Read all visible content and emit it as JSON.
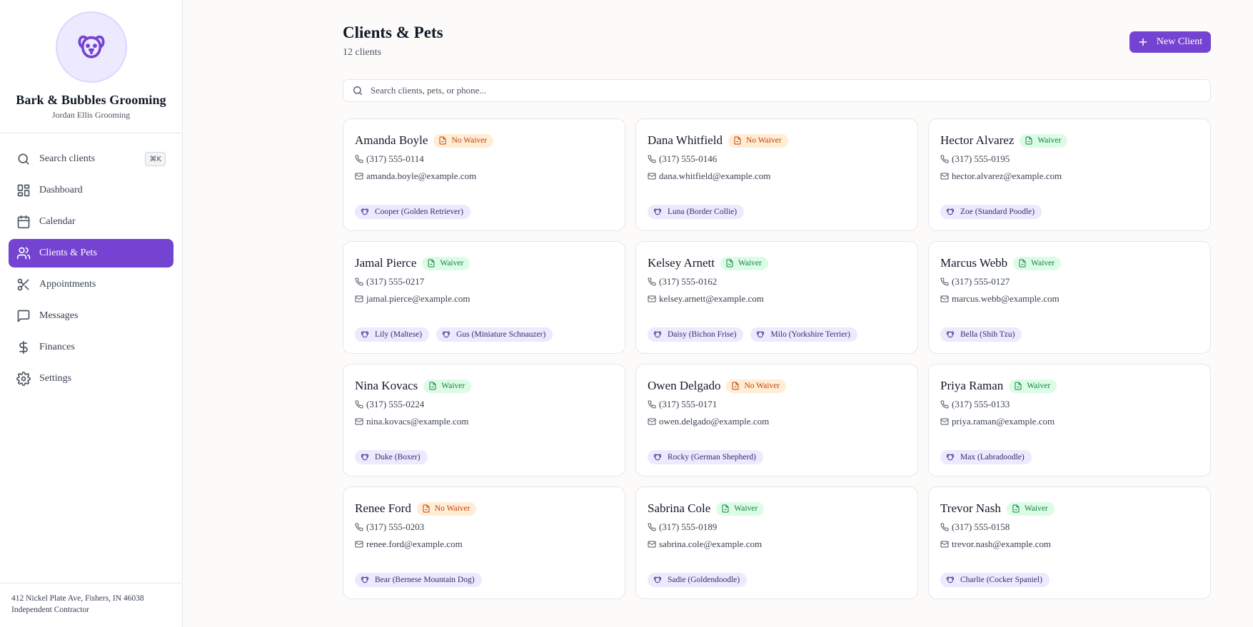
{
  "brand": {
    "name": "Bark & Bubbles Grooming",
    "subtitle": "Jordan Ellis Grooming"
  },
  "nav": [
    {
      "label": "Search clients",
      "icon": "search-icon",
      "shortcut": "⌘K"
    },
    {
      "label": "Dashboard",
      "icon": "dashboard-icon"
    },
    {
      "label": "Calendar",
      "icon": "calendar-icon"
    },
    {
      "label": "Clients & Pets",
      "icon": "users-icon",
      "active": true
    },
    {
      "label": "Appointments",
      "icon": "scissors-icon"
    },
    {
      "label": "Messages",
      "icon": "message-icon"
    },
    {
      "label": "Finances",
      "icon": "dollar-icon"
    },
    {
      "label": "Settings",
      "icon": "gear-icon"
    }
  ],
  "footer": {
    "address": "412 Nickel Plate Ave, Fishers, IN 46038",
    "role": "Independent Contractor"
  },
  "header": {
    "title": "Clients & Pets",
    "count": "12 clients",
    "new_button": "New Client"
  },
  "search": {
    "placeholder": "Search clients, pets, or phone..."
  },
  "colors": {
    "accent": "#7443d2",
    "waiver_bg": "#dcfce7",
    "no_waiver_bg": "#ffedd5",
    "pet_bg": "#ede9fe"
  },
  "clients": [
    {
      "name": "Amanda Boyle",
      "waiver": "No Waiver",
      "phone": "(317) 555-0114",
      "email": "amanda.boyle@example.com",
      "pets": [
        "Cooper (Golden Retriever)"
      ]
    },
    {
      "name": "Dana Whitfield",
      "waiver": "No Waiver",
      "phone": "(317) 555-0146",
      "email": "dana.whitfield@example.com",
      "pets": [
        "Luna (Border Collie)"
      ]
    },
    {
      "name": "Hector Alvarez",
      "waiver": "Waiver",
      "phone": "(317) 555-0195",
      "email": "hector.alvarez@example.com",
      "pets": [
        "Zoe (Standard Poodle)"
      ]
    },
    {
      "name": "Jamal Pierce",
      "waiver": "Waiver",
      "phone": "(317) 555-0217",
      "email": "jamal.pierce@example.com",
      "pets": [
        "Lily (Maltese)",
        "Gus (Miniature Schnauzer)"
      ]
    },
    {
      "name": "Kelsey Arnett",
      "waiver": "Waiver",
      "phone": "(317) 555-0162",
      "email": "kelsey.arnett@example.com",
      "pets": [
        "Daisy (Bichon Frise)",
        "Milo (Yorkshire Terrier)"
      ]
    },
    {
      "name": "Marcus Webb",
      "waiver": "Waiver",
      "phone": "(317) 555-0127",
      "email": "marcus.webb@example.com",
      "pets": [
        "Bella (Shih Tzu)"
      ]
    },
    {
      "name": "Nina Kovacs",
      "waiver": "Waiver",
      "phone": "(317) 555-0224",
      "email": "nina.kovacs@example.com",
      "pets": [
        "Duke (Boxer)"
      ]
    },
    {
      "name": "Owen Delgado",
      "waiver": "No Waiver",
      "phone": "(317) 555-0171",
      "email": "owen.delgado@example.com",
      "pets": [
        "Rocky (German Shepherd)"
      ]
    },
    {
      "name": "Priya Raman",
      "waiver": "Waiver",
      "phone": "(317) 555-0133",
      "email": "priya.raman@example.com",
      "pets": [
        "Max (Labradoodle)"
      ]
    },
    {
      "name": "Renee Ford",
      "waiver": "No Waiver",
      "phone": "(317) 555-0203",
      "email": "renee.ford@example.com",
      "pets": [
        "Bear (Bernese Mountain Dog)"
      ]
    },
    {
      "name": "Sabrina Cole",
      "waiver": "Waiver",
      "phone": "(317) 555-0189",
      "email": "sabrina.cole@example.com",
      "pets": [
        "Sadie (Goldendoodle)"
      ]
    },
    {
      "name": "Trevor Nash",
      "waiver": "Waiver",
      "phone": "(317) 555-0158",
      "email": "trevor.nash@example.com",
      "pets": [
        "Charlie (Cocker Spaniel)"
      ]
    }
  ]
}
